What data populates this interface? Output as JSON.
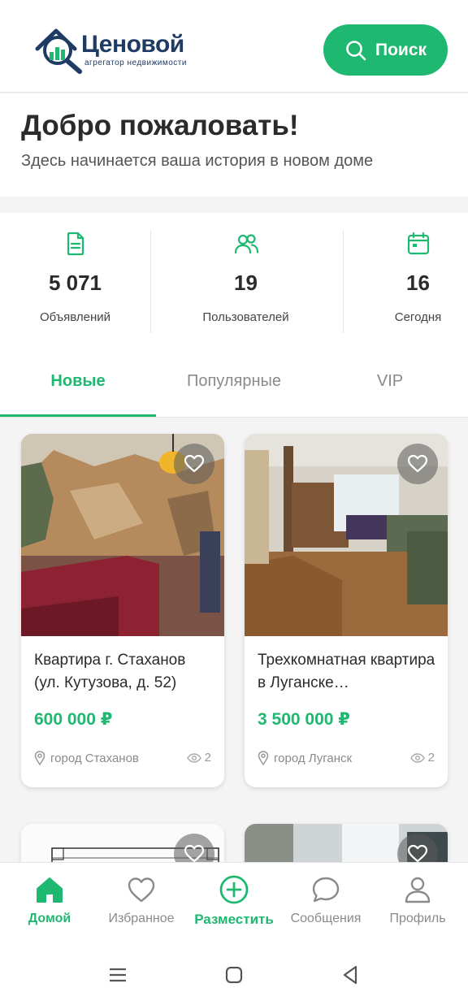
{
  "header": {
    "logo_name": "Ценовой",
    "logo_sub": "агрегатор недвижимости",
    "search_label": "Поиск"
  },
  "welcome": {
    "title": "Добро пожаловать!",
    "subtitle": "Здесь начинается ваша история в новом доме"
  },
  "stats": [
    {
      "icon": "document-icon",
      "value": "5 071",
      "label": "Объявлений"
    },
    {
      "icon": "users-icon",
      "value": "19",
      "label": "Пользователей"
    },
    {
      "icon": "calendar-icon",
      "value": "16",
      "label": "Сегодня"
    }
  ],
  "tabs": [
    {
      "label": "Новые",
      "active": true
    },
    {
      "label": "Популярные",
      "active": false
    },
    {
      "label": "VIP",
      "active": false
    }
  ],
  "listings": [
    {
      "title": "Квартира г. Стаханов (ул. Кутузова, д. 52)",
      "price": "600 000 ₽",
      "location": "город Стаханов",
      "views": "2"
    },
    {
      "title": "Трехкомнатная квартира в Луганске…",
      "price": "3 500 000 ₽",
      "location": "город Луганск",
      "views": "2"
    }
  ],
  "bottom_nav": [
    {
      "label": "Домой",
      "icon": "home-icon",
      "active": true
    },
    {
      "label": "Избранное",
      "icon": "heart-icon",
      "active": false
    },
    {
      "label": "Разместить",
      "icon": "plus-circle-icon",
      "active": false
    },
    {
      "label": "Сообщения",
      "icon": "chat-icon",
      "active": false
    },
    {
      "label": "Профиль",
      "icon": "user-icon",
      "active": false
    }
  ],
  "colors": {
    "accent": "#1fb871",
    "brand": "#1f3b63"
  }
}
